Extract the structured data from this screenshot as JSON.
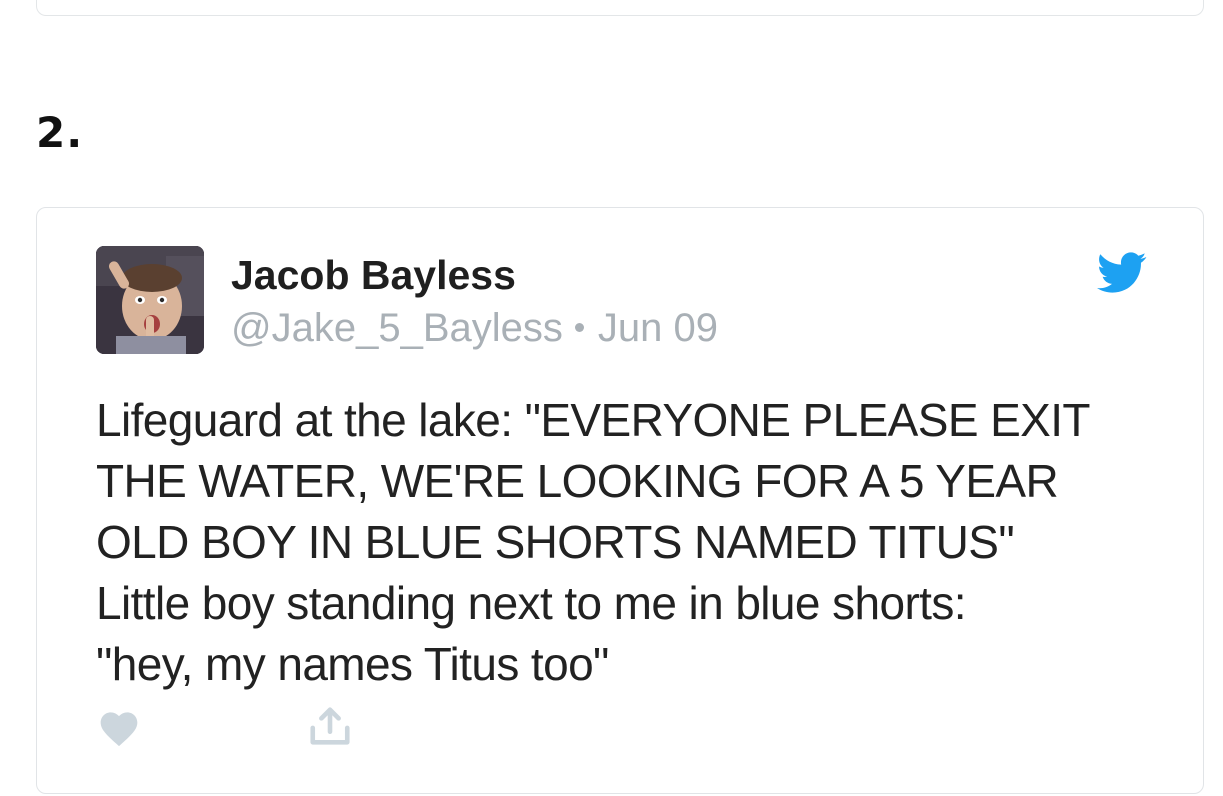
{
  "list_number": "2.",
  "tweet": {
    "display_name": "Jacob Bayless",
    "handle": "@Jake_5_Bayless",
    "date": "Jun 09",
    "text": "Lifeguard at the lake: \"EVERYONE PLEASE EXIT\nTHE WATER, WE'RE LOOKING FOR A 5 YEAR\nOLD BOY IN BLUE SHORTS NAMED TITUS\"\nLittle boy standing next to me in blue shorts:\n\"hey, my names Titus too\"",
    "avatar_icon": "profile-photo",
    "brand_icon": "twitter-bird-icon",
    "actions": {
      "like_icon": "heart-icon",
      "share_icon": "share-icon"
    }
  },
  "colors": {
    "twitter_blue": "#1da1f2",
    "meta_gray": "#a9b0b6",
    "action_gray": "#ccd6dd",
    "border": "#e1e4e7"
  }
}
